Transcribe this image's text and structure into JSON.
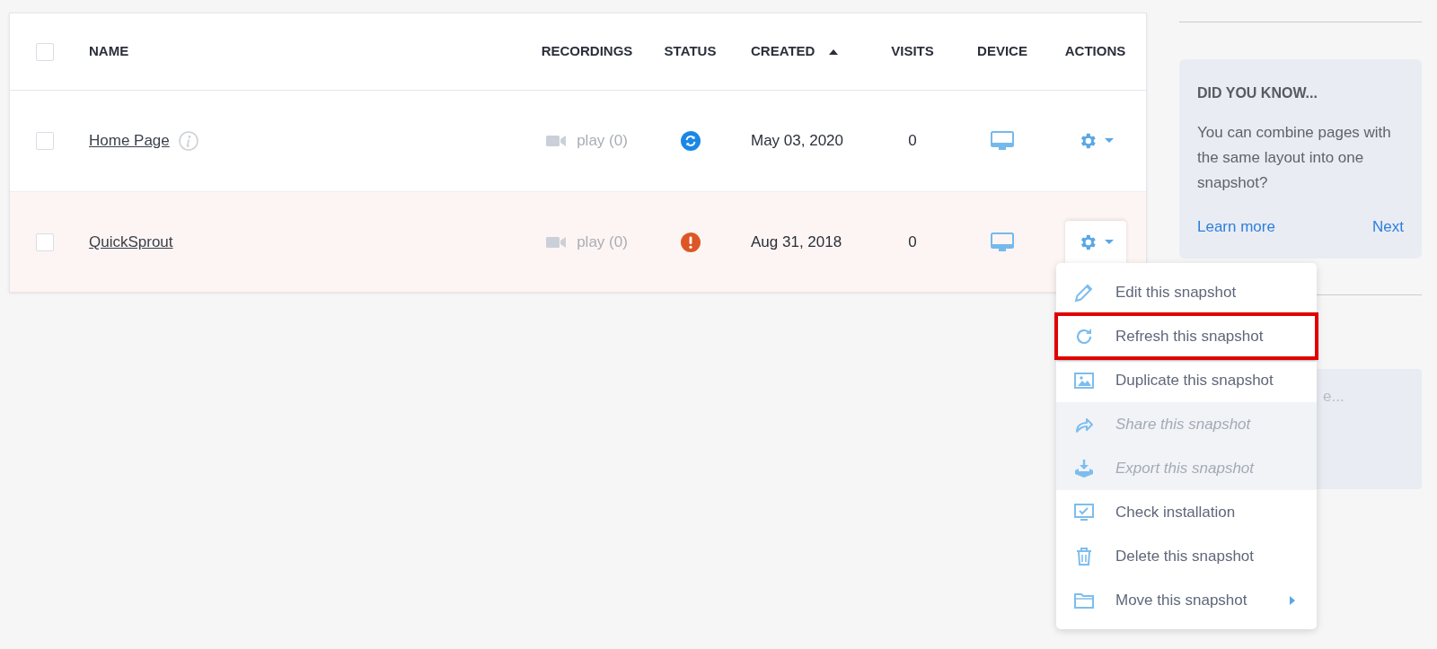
{
  "table": {
    "columns": [
      {
        "label": "NAME",
        "centered": false,
        "sorted": false
      },
      {
        "label": "RECORDINGS",
        "centered": true,
        "sorted": false
      },
      {
        "label": "STATUS",
        "centered": true,
        "sorted": false
      },
      {
        "label": "CREATED",
        "centered": false,
        "sorted": true
      },
      {
        "label": "VISITS",
        "centered": true,
        "sorted": false
      },
      {
        "label": "DEVICE",
        "centered": true,
        "sorted": false
      },
      {
        "label": "ACTIONS",
        "centered": true,
        "sorted": false
      }
    ],
    "select_all": {
      "checked": false
    },
    "rows": [
      {
        "checked": false,
        "name": "Home Page",
        "info": true,
        "recordings": "play (0)",
        "status": {
          "kind": "synced"
        },
        "created": "May 03, 2020",
        "visits": "0",
        "device": {
          "kind": "desktop"
        },
        "menu_open": false
      },
      {
        "checked": false,
        "name": "QuickSprout",
        "info": false,
        "recordings": "play (0)",
        "status": {
          "kind": "error"
        },
        "created": "Aug 31, 2018",
        "visits": "0",
        "device": {
          "kind": "desktop"
        },
        "menu_open": true
      }
    ]
  },
  "actions_menu": {
    "items": [
      {
        "kind": "edit",
        "label": "Edit this snapshot",
        "disabled": false,
        "highlighted": false,
        "submenu": false
      },
      {
        "kind": "refresh",
        "label": "Refresh this snapshot",
        "disabled": false,
        "highlighted": true,
        "submenu": false
      },
      {
        "kind": "duplicate",
        "label": "Duplicate this snapshot",
        "disabled": false,
        "highlighted": false,
        "submenu": false
      },
      {
        "kind": "share",
        "label": "Share this snapshot",
        "disabled": true,
        "highlighted": false,
        "submenu": false
      },
      {
        "kind": "export",
        "label": "Export this snapshot",
        "disabled": true,
        "highlighted": false,
        "submenu": false
      },
      {
        "kind": "check",
        "label": "Check installation",
        "disabled": false,
        "highlighted": false,
        "submenu": false
      },
      {
        "kind": "delete",
        "label": "Delete this snapshot",
        "disabled": false,
        "highlighted": false,
        "submenu": false
      },
      {
        "kind": "move",
        "label": "Move this snapshot",
        "disabled": false,
        "highlighted": false,
        "submenu": true
      }
    ]
  },
  "sidebar": {
    "tip_card": {
      "title": "DID YOU KNOW...",
      "text": "You can combine pages with the same layout into one snapshot?",
      "links": [
        "Learn more",
        "Next"
      ]
    },
    "second_card": {
      "text": "e..."
    }
  }
}
